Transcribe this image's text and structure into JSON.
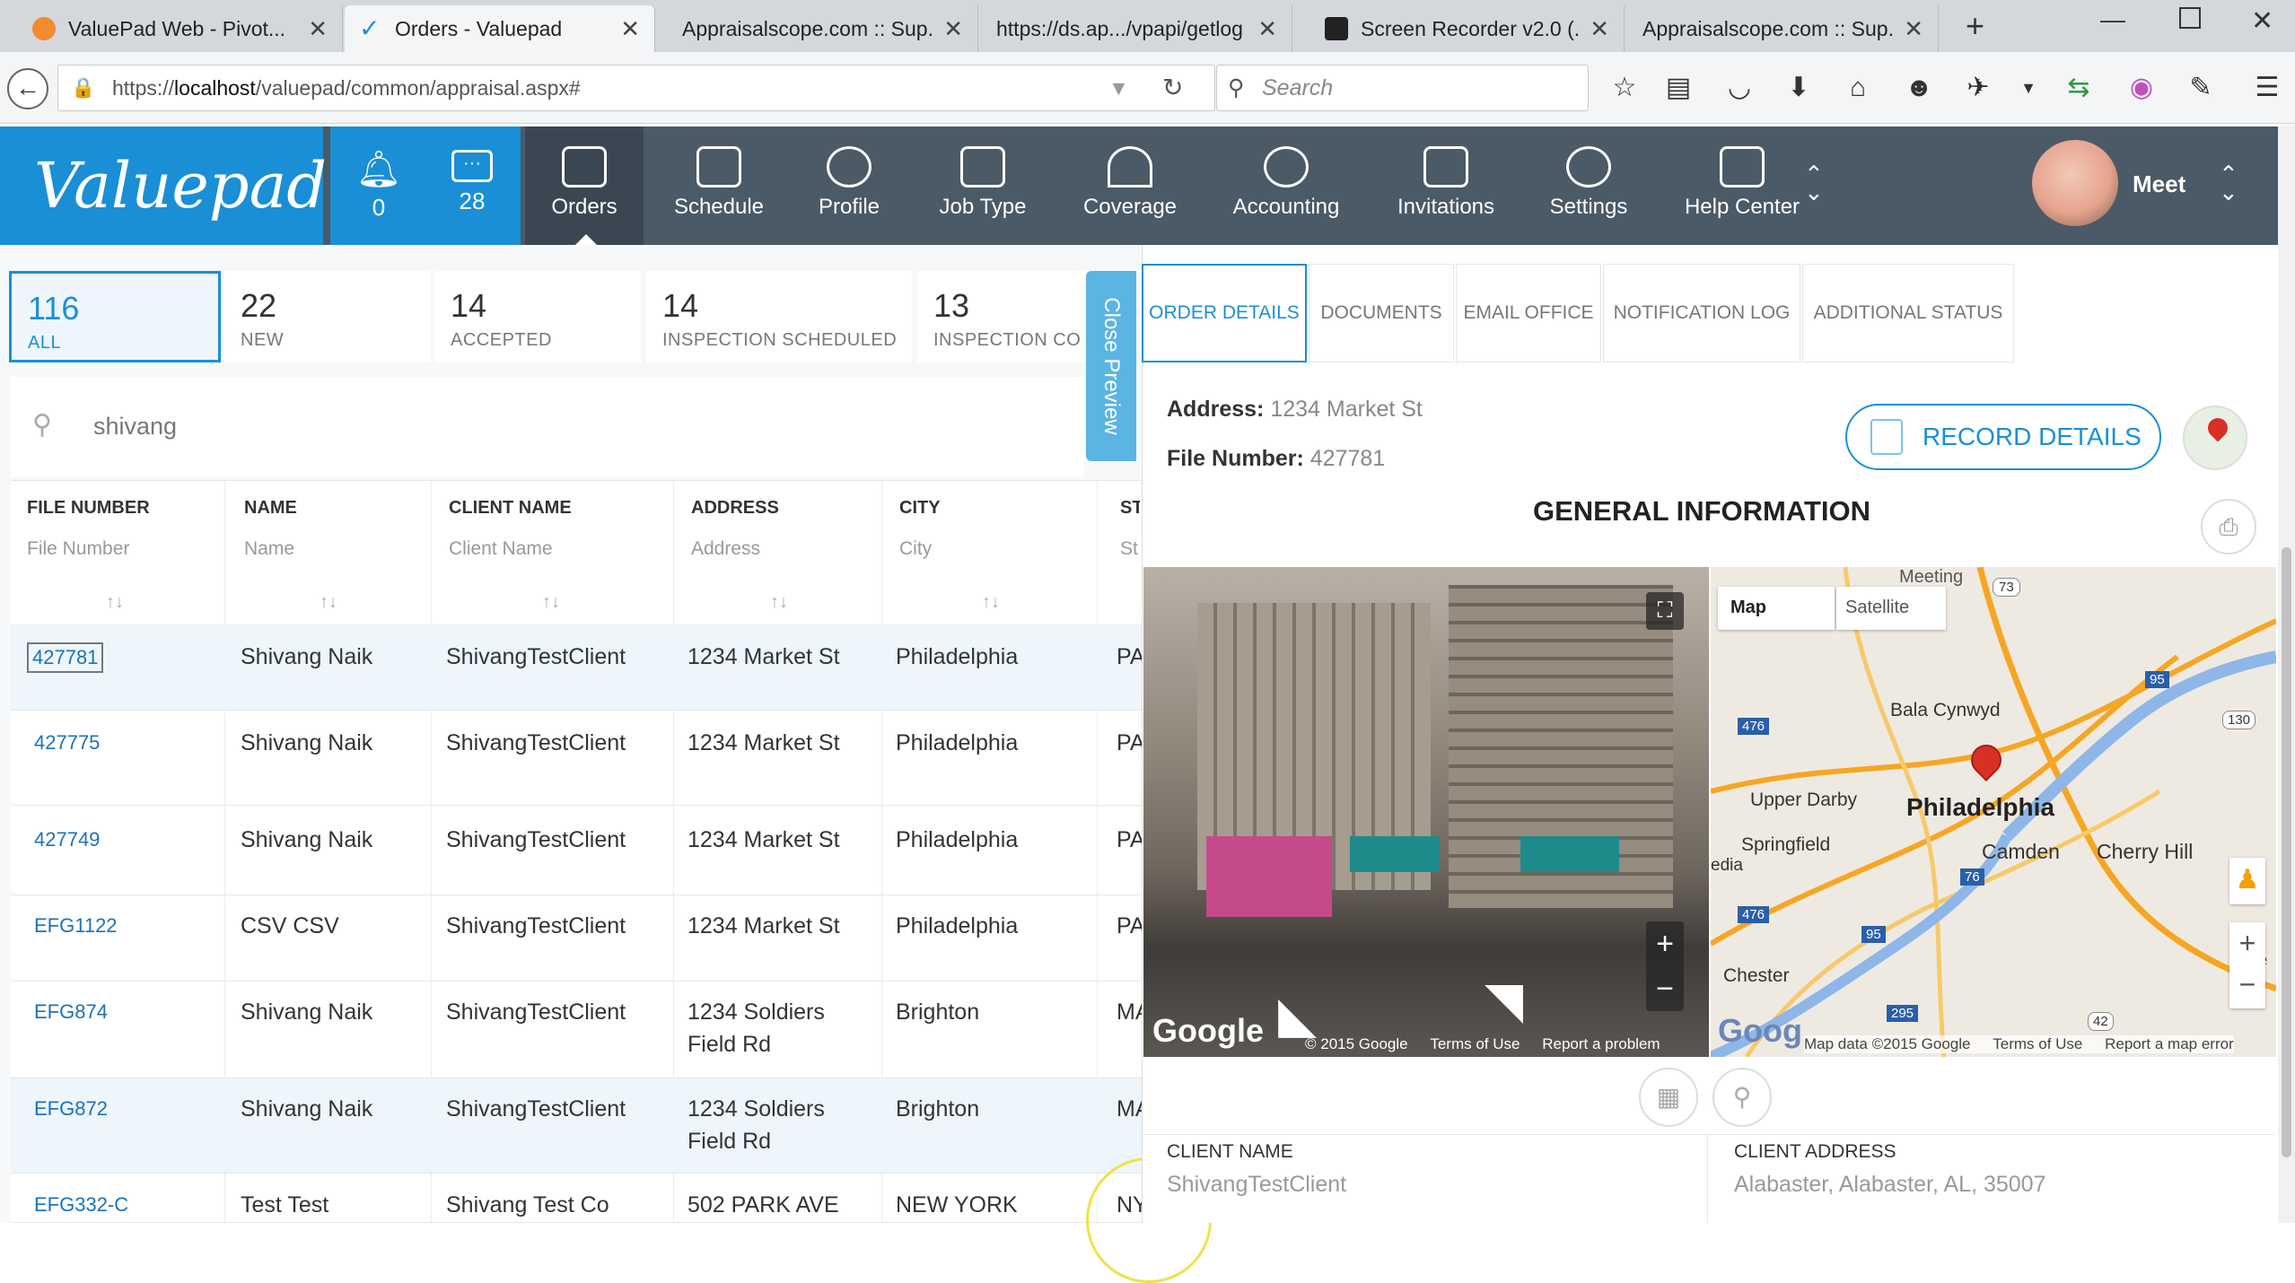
{
  "browser": {
    "tabs": [
      {
        "title": "ValuePad Web - Pivot..."
      },
      {
        "title": "Orders - Valuepad"
      },
      {
        "title": "Appraisalscope.com :: Sup..."
      },
      {
        "title": "https://ds.ap.../vpapi/getlog"
      },
      {
        "title": "Screen Recorder v2.0 (..."
      },
      {
        "title": "Appraisalscope.com :: Sup..."
      }
    ],
    "url_prefix": "https://",
    "url_host": "localhost",
    "url_path": "/valuepad/common/appraisal.aspx#",
    "search_placeholder": "Search"
  },
  "app": {
    "logo": "Valuepad",
    "notifications": [
      {
        "count": "0"
      },
      {
        "count": "28"
      }
    ],
    "nav": [
      {
        "label": "Orders"
      },
      {
        "label": "Schedule"
      },
      {
        "label": "Profile"
      },
      {
        "label": "Job Type"
      },
      {
        "label": "Coverage"
      },
      {
        "label": "Accounting"
      },
      {
        "label": "Invitations"
      },
      {
        "label": "Settings"
      },
      {
        "label": "Help Center"
      }
    ],
    "user": "Meet"
  },
  "status_tiles": [
    {
      "count": "116",
      "label": "ALL"
    },
    {
      "count": "22",
      "label": "NEW"
    },
    {
      "count": "14",
      "label": "ACCEPTED"
    },
    {
      "count": "14",
      "label": "INSPECTION SCHEDULED"
    },
    {
      "count": "13",
      "label": "INSPECTION CO"
    }
  ],
  "close_preview": "Close Preview",
  "search_value": "shivang",
  "table": {
    "columns": [
      {
        "header": "FILE NUMBER",
        "filter": "File Number"
      },
      {
        "header": "NAME",
        "filter": "Name"
      },
      {
        "header": "CLIENT NAME",
        "filter": "Client Name"
      },
      {
        "header": "ADDRESS",
        "filter": "Address"
      },
      {
        "header": "CITY",
        "filter": "City"
      },
      {
        "header": "ST",
        "filter": "St"
      }
    ],
    "sort_glyph": "↑↓",
    "rows": [
      {
        "file": "427781",
        "name": "Shivang Naik",
        "client": "ShivangTestClient",
        "address": "1234 Market St",
        "address2": "",
        "city": "Philadelphia",
        "st": "PA"
      },
      {
        "file": "427775",
        "name": "Shivang Naik",
        "client": "ShivangTestClient",
        "address": "1234 Market St",
        "address2": "",
        "city": "Philadelphia",
        "st": "PA"
      },
      {
        "file": "427749",
        "name": "Shivang Naik",
        "client": "ShivangTestClient",
        "address": "1234 Market St",
        "address2": "",
        "city": "Philadelphia",
        "st": "PA"
      },
      {
        "file": "EFG1122",
        "name": "CSV CSV",
        "client": "ShivangTestClient",
        "address": "1234 Market St",
        "address2": "",
        "city": "Philadelphia",
        "st": "PA"
      },
      {
        "file": "EFG874",
        "name": "Shivang Naik",
        "client": "ShivangTestClient",
        "address": "1234 Soldiers",
        "address2": "Field Rd",
        "city": "Brighton",
        "st": "MA"
      },
      {
        "file": "EFG872",
        "name": "Shivang Naik",
        "client": "ShivangTestClient",
        "address": "1234 Soldiers",
        "address2": "Field Rd",
        "city": "Brighton",
        "st": "MA"
      },
      {
        "file": "EFG332-C",
        "name": "Test Test",
        "client": "Shivang Test Co",
        "address": "502 PARK AVE",
        "address2": "",
        "city": "NEW YORK",
        "st": "NY"
      }
    ]
  },
  "details": {
    "tabs": [
      {
        "label": "ORDER DETAILS"
      },
      {
        "label": "DOCUMENTS"
      },
      {
        "label": "EMAIL OFFICE"
      },
      {
        "label": "NOTIFICATION LOG"
      },
      {
        "label": "ADDITIONAL STATUS"
      }
    ],
    "address_label": "Address:",
    "address_value": "1234 Market St",
    "file_label": "File Number:",
    "file_value": "427781",
    "record_button": "RECORD DETAILS",
    "section_title": "GENERAL INFORMATION",
    "streetview": {
      "brand": "Google",
      "copyright": "© 2015 Google",
      "terms": "Terms of Use",
      "report": "Report a problem"
    },
    "map": {
      "map_btn": "Map",
      "satellite_btn": "Satellite",
      "labels": [
        "Philadelphia",
        "Bala Cynwyd",
        "Upper Darby",
        "Springfield",
        "Camden",
        "Cherry Hill",
        "Chester",
        "Meeting"
      ],
      "shields": [
        "73",
        "476",
        "95",
        "130",
        "76",
        "476",
        "95",
        "295",
        "42"
      ],
      "edge_labels": [
        "edia",
        "Ve",
        "To"
      ],
      "data": "Map data ©2015 Google",
      "terms": "Terms of Use",
      "report": "Report a map error"
    },
    "client_name_label": "CLIENT NAME",
    "client_name_value": "ShivangTestClient",
    "client_address_label": "CLIENT ADDRESS",
    "client_address_value": "Alabaster, Alabaster, AL, 35007"
  },
  "colors": {
    "brand_blue": "#1a8fd6",
    "header_dark": "#4a5a66",
    "pin_red": "#d93025"
  }
}
